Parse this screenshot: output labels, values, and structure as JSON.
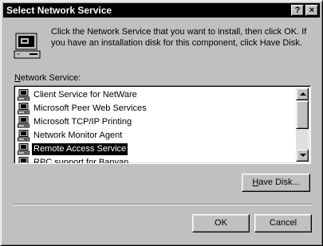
{
  "window": {
    "title": "Select Network Service",
    "help_button": "?",
    "close_button": "×"
  },
  "intro_text": "Click the Network Service that you want to install, then click OK.  If you have an installation disk for this component, click Have Disk.",
  "list": {
    "label_underlined": "N",
    "label_rest": "etwork Service:",
    "items": [
      {
        "label": "Client Service for NetWare",
        "icon": "network-computer-icon",
        "selected": false
      },
      {
        "label": "Microsoft Peer Web Services",
        "icon": "network-computer-icon",
        "selected": false
      },
      {
        "label": "Microsoft TCP/IP Printing",
        "icon": "network-computer-icon",
        "selected": false
      },
      {
        "label": "Network Monitor Agent",
        "icon": "network-computer-icon",
        "selected": false
      },
      {
        "label": "Remote Access Service",
        "icon": "network-computer-icon",
        "selected": true
      },
      {
        "label": "RPC support for Banyan",
        "icon": "network-computer-icon",
        "selected": false
      }
    ]
  },
  "buttons": {
    "have_disk_underlined": "H",
    "have_disk_rest": "ave Disk...",
    "ok": "OK",
    "cancel": "Cancel"
  }
}
